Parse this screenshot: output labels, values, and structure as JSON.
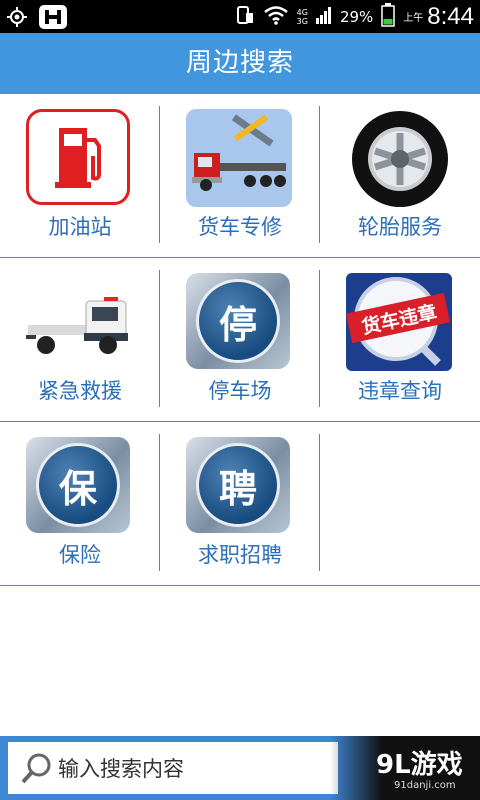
{
  "status_bar": {
    "network_top": "4G",
    "network_bottom": "3G",
    "battery": "29%",
    "ampm": "上午",
    "time": "8:44"
  },
  "header": {
    "title": "周边搜索"
  },
  "grid": [
    [
      {
        "label": "加油站",
        "icon": "gas-pump-icon"
      },
      {
        "label": "货车专修",
        "icon": "truck-repair-icon"
      },
      {
        "label": "轮胎服务",
        "icon": "tire-icon"
      }
    ],
    [
      {
        "label": "紧急救援",
        "icon": "tow-truck-icon"
      },
      {
        "label": "停车场",
        "icon": "parking-icon",
        "glyph": "停"
      },
      {
        "label": "违章查询",
        "icon": "violation-query-icon",
        "glyph": "货车违章"
      }
    ],
    [
      {
        "label": "保险",
        "icon": "insurance-icon",
        "glyph": "保"
      },
      {
        "label": "求职招聘",
        "icon": "recruitment-icon",
        "glyph": "聘"
      }
    ]
  ],
  "search": {
    "placeholder": "输入搜索内容"
  },
  "watermark": {
    "brand": "9L游戏",
    "url": "91danji.com"
  },
  "colors": {
    "header": "#4296de",
    "divider": "#3d8bd6",
    "label": "#2c6fb8"
  }
}
